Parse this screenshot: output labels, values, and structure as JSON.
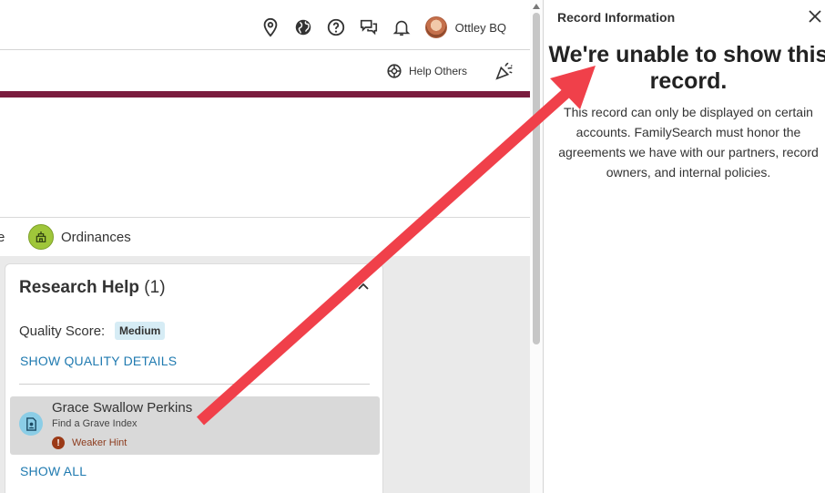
{
  "header": {
    "username": "Ottley BQ",
    "icons": [
      "location-pin-icon",
      "globe-icon",
      "help-circle-icon",
      "chat-icon",
      "bell-icon"
    ],
    "help_others": "Help Others"
  },
  "tabs": {
    "partial_tab": "e",
    "ordinances": "Ordinances"
  },
  "research_help": {
    "title": "Research Help",
    "count": "(1)",
    "quality_label": "Quality Score:",
    "quality_value": "Medium",
    "show_quality": "SHOW QUALITY DETAILS",
    "hint": {
      "name": "Grace Swallow Perkins",
      "source": "Find a Grave Index",
      "strength": "Weaker Hint"
    },
    "show_all": "SHOW ALL"
  },
  "record_panel": {
    "title": "Record Information",
    "heading": "We're unable to show this record.",
    "body": "This record can only be displayed on certain accounts. FamilySearch must honor the agreements we have with our partners, record owners, and internal policies."
  },
  "colors": {
    "accent_bar": "#7a1c3e",
    "link": "#1f7ab0",
    "arrow": "#f0404a",
    "ordinance_icon": "#9fc63a",
    "hint_warning": "#9b3a17"
  }
}
